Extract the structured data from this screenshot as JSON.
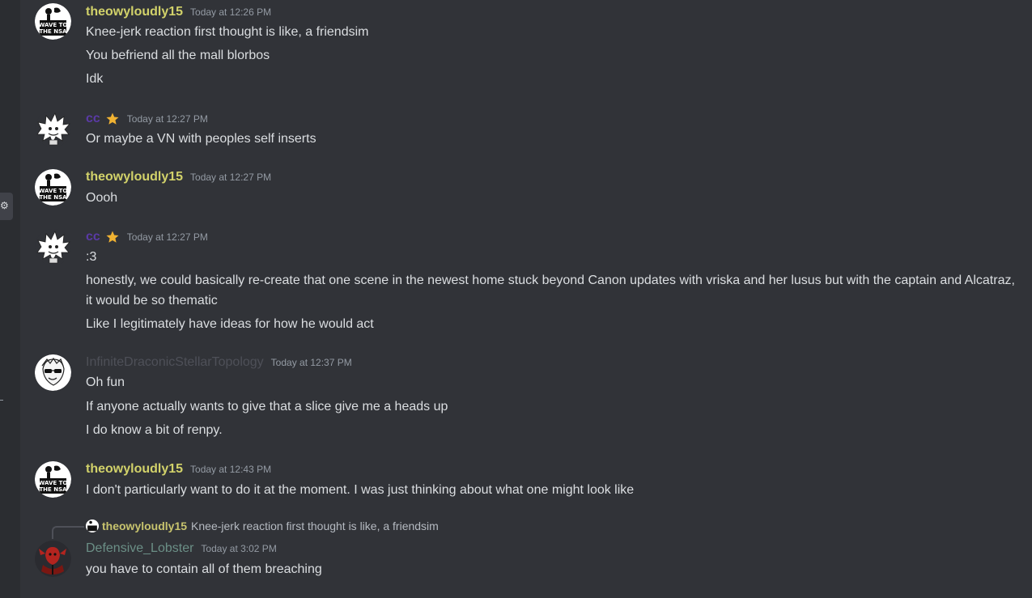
{
  "rail": {
    "gear_glyph": "⚙"
  },
  "colors": {
    "theowy": "#d2d26a",
    "cc": "#5a3aa6",
    "infinite": "#4e5058",
    "lobster": "#6b8f86",
    "star": "#f0b232"
  },
  "messages": [
    {
      "avatar": "wave-to-the-nsa",
      "avatar_text": [
        "WAVE TO",
        "THE NSA"
      ],
      "username": "theowyloudly15",
      "timestamp": "Today at 12:26 PM",
      "lines": [
        "Knee-jerk reaction first thought is like, a friendsim",
        "You befriend all the mall blorbos",
        "Idk"
      ]
    },
    {
      "avatar": "spiky-creature",
      "username": "cc",
      "badge": "star-icon",
      "timestamp": "Today at 12:27 PM",
      "lines": [
        "Or maybe a VN with peoples self inserts"
      ]
    },
    {
      "avatar": "wave-to-the-nsa",
      "avatar_text": [
        "WAVE TO",
        "THE NSA"
      ],
      "username": "theowyloudly15",
      "timestamp": "Today at 12:27 PM",
      "lines": [
        "Oooh"
      ]
    },
    {
      "avatar": "spiky-creature",
      "username": "cc",
      "badge": "star-icon",
      "timestamp": "Today at 12:27 PM",
      "lines": [
        ":3",
        "honestly, we could basically re-create that one scene in the newest home stuck beyond Canon updates with vriska and her lusus but with the captain and Alcatraz, it would be so thematic",
        "Like I legitimately have ideas for how he would act"
      ]
    },
    {
      "avatar": "sunglasses-face",
      "username": "InfiniteDraconicStellarTopology",
      "timestamp": "Today at 12:37 PM",
      "lines": [
        "Oh fun",
        "If anyone actually wants to give that a slice give me a heads up",
        "I do know a bit of renpy."
      ]
    },
    {
      "avatar": "wave-to-the-nsa",
      "avatar_text": [
        "WAVE TO",
        "THE NSA"
      ],
      "username": "theowyloudly15",
      "timestamp": "Today at 12:43 PM",
      "lines": [
        "I don't particularly want to do it at the moment. I was just thinking about what one might look like"
      ]
    },
    {
      "avatar": "red-lobster",
      "username": "Defensive_Lobster",
      "timestamp": "Today at 3:02 PM",
      "reply": {
        "username": "theowyloudly15",
        "text": "Knee-jerk reaction first thought is like, a friendsim"
      },
      "lines": [
        "you have to contain all of them breaching"
      ]
    }
  ]
}
